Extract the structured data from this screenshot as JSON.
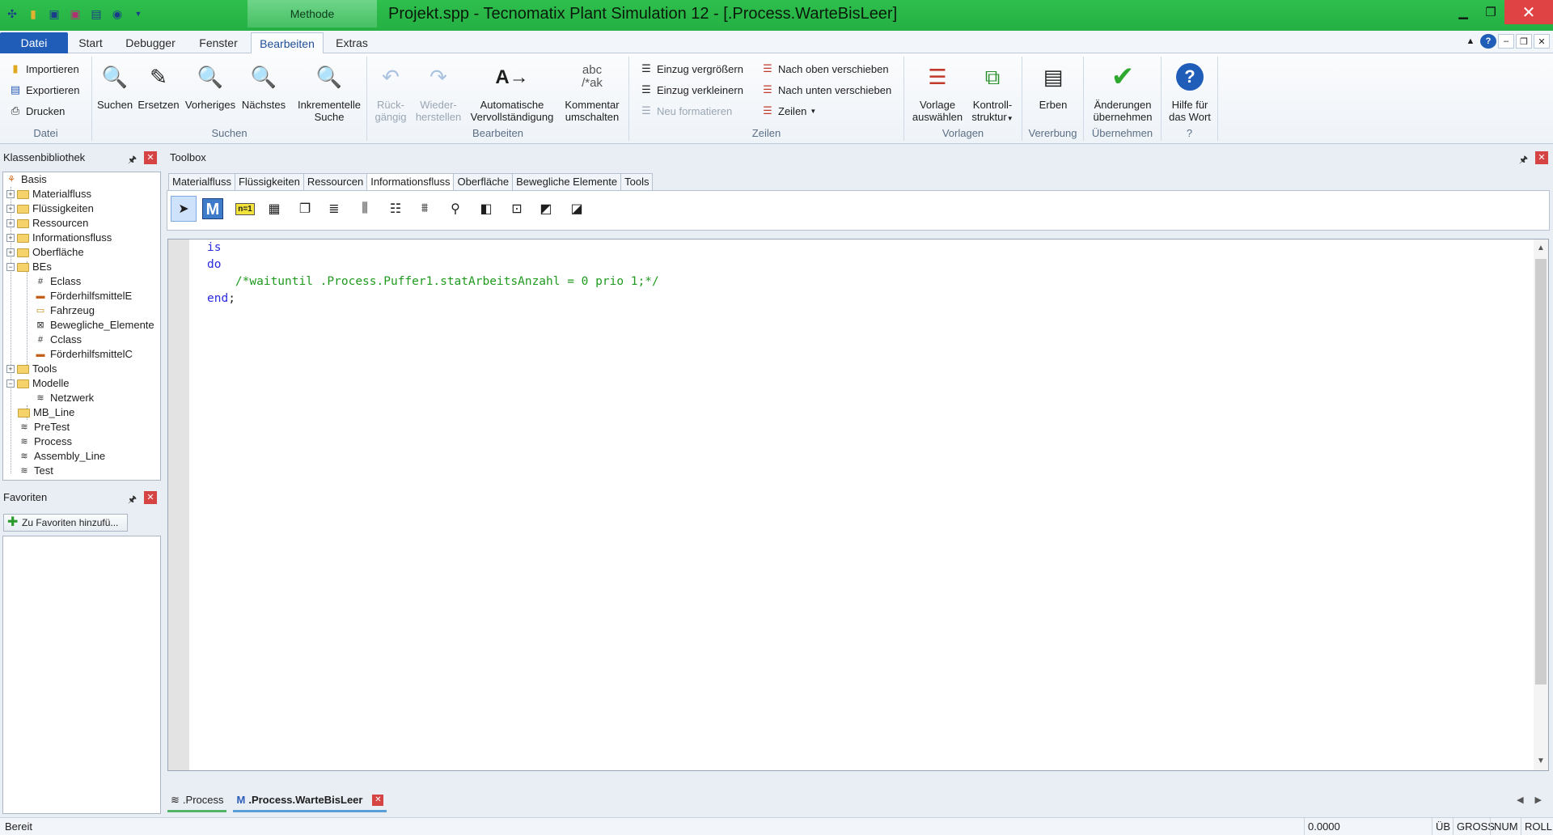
{
  "window": {
    "title": "Projekt.spp - Tecnomatix Plant Simulation 12 - [.Process.WarteBisLeer]",
    "context_tab": "Methode"
  },
  "ribbon_tabs": [
    "Datei",
    "Start",
    "Debugger",
    "Fenster",
    "Bearbeiten",
    "Extras"
  ],
  "ribbon": {
    "datei": {
      "label": "Datei",
      "items": [
        "Importieren",
        "Exportieren",
        "Drucken"
      ]
    },
    "suchen": {
      "label": "Suchen",
      "items": [
        "Suchen",
        "Ersetzen",
        "Vorheriges",
        "Nächstes"
      ],
      "inkrementelle_l1": "Inkrementelle",
      "inkrementelle_l2": "Suche"
    },
    "bearbeiten": {
      "label": "Bearbeiten",
      "undo_l1": "Rück-",
      "undo_l2": "gängig",
      "redo_l1": "Wieder-",
      "redo_l2": "herstellen",
      "auto_l1": "Automatische",
      "auto_l2": "Vervollständigung",
      "comment_l1": "Kommentar",
      "comment_l2": "umschalten",
      "comment_icon_top": "abc",
      "comment_icon_bottom": "/*ak"
    },
    "zeilen": {
      "label": "Zeilen",
      "items": [
        "Einzug vergrößern",
        "Einzug verkleinern",
        "Neu formatieren",
        "Nach oben verschieben",
        "Nach unten verschieben",
        "Zeilen"
      ]
    },
    "vorlagen": {
      "label": "Vorlagen",
      "vorlage_l1": "Vorlage",
      "vorlage_l2": "auswählen",
      "kontroll_l1": "Kontroll-",
      "kontroll_l2": "struktur"
    },
    "vererbung": {
      "label": "Vererbung",
      "erben": "Erben"
    },
    "uebernehmen": {
      "label": "Übernehmen",
      "l1": "Änderungen",
      "l2": "übernehmen"
    },
    "hilfe": {
      "label": "?",
      "l1": "Hilfe für",
      "l2": "das Wort"
    }
  },
  "klassenbibliothek": {
    "title": "Klassenbibliothek",
    "tree": [
      "Basis",
      "Materialfluss",
      "Flüssigkeiten",
      "Ressourcen",
      "Informationsfluss",
      "Oberfläche",
      "BEs",
      "Eclass",
      "FörderhilfsmittelE",
      "Fahrzeug",
      "Bewegliche_Elemente",
      "Cclass",
      "FörderhilfsmittelC",
      "Tools",
      "Modelle",
      "Netzwerk",
      "MB_Line",
      "PreTest",
      "Process",
      "Assembly_Line",
      "Test"
    ]
  },
  "favoriten": {
    "title": "Favoriten",
    "add_button": "Zu Favoriten hinzufü..."
  },
  "toolbox": {
    "title": "Toolbox",
    "tabs": [
      "Materialfluss",
      "Flüssigkeiten",
      "Ressourcen",
      "Informationsfluss",
      "Oberfläche",
      "Bewegliche Elemente",
      "Tools"
    ],
    "icon_n1": "n=1",
    "icon_m": "M"
  },
  "editor": {
    "lines": [
      {
        "indent": "",
        "text": "is",
        "cls": "kw"
      },
      {
        "indent": "",
        "text": "do",
        "cls": "kw"
      },
      {
        "indent": "    ",
        "text": "/*waituntil .Process.Puffer1.statArbeitsAnzahl = 0 prio 1;*/",
        "cls": "cm"
      },
      {
        "indent": "",
        "text": "end",
        "cls": "kw",
        "tail": ";"
      }
    ]
  },
  "doc_tabs": [
    ".Process",
    ".Process.WarteBisLeer"
  ],
  "status": {
    "text": "Bereit",
    "value": "0.0000",
    "flags": [
      "ÜB",
      "GROSS",
      "NUM",
      "ROLL"
    ]
  }
}
